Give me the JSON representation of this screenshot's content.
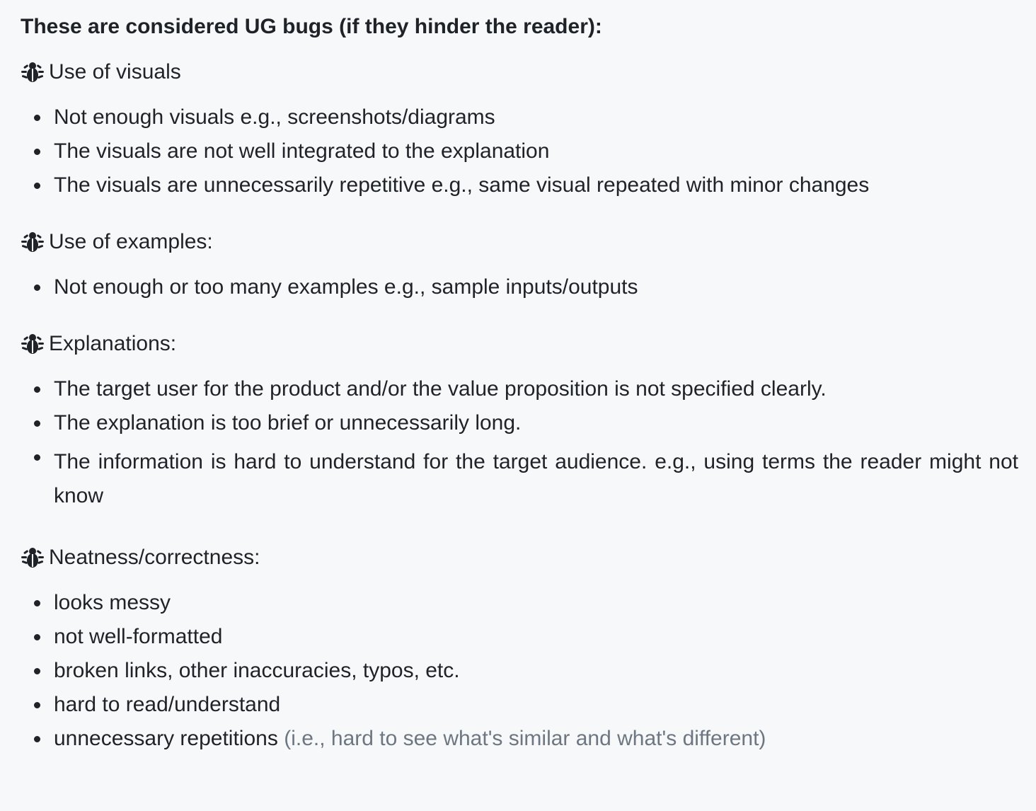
{
  "heading": "These are considered UG bugs (if they hinder the reader):",
  "sections": [
    {
      "icon": "bug-icon",
      "title": "Use of visuals",
      "items": [
        "Not enough visuals e.g., screenshots/diagrams",
        "The visuals are not well integrated to the explanation",
        "The visuals are unnecessarily repetitive e.g., same visual repeated with minor changes"
      ]
    },
    {
      "icon": "bug-icon",
      "title": "Use of examples:",
      "items": [
        "Not enough or too many examples e.g., sample inputs/outputs"
      ]
    },
    {
      "icon": "bug-icon",
      "title": "Explanations:",
      "items": [
        "The target user for the product and/or the value proposition is not specified clearly.",
        "The explanation is too brief or unnecessarily long.",
        "The information is hard to understand for the target audience. e.g., using terms the reader might not know"
      ]
    },
    {
      "icon": "bug-icon",
      "title": "Neatness/correctness:",
      "items": [
        "looks messy",
        "not well-formatted",
        "broken links, other inaccuracies, typos, etc.",
        "hard to read/understand",
        "unnecessary repetitions"
      ],
      "last_item_note": "(i.e., hard to see what's similar and what's different)"
    }
  ],
  "colors": {
    "background": "#f6f8fa",
    "text": "#1f2328",
    "muted": "#6e7781"
  }
}
